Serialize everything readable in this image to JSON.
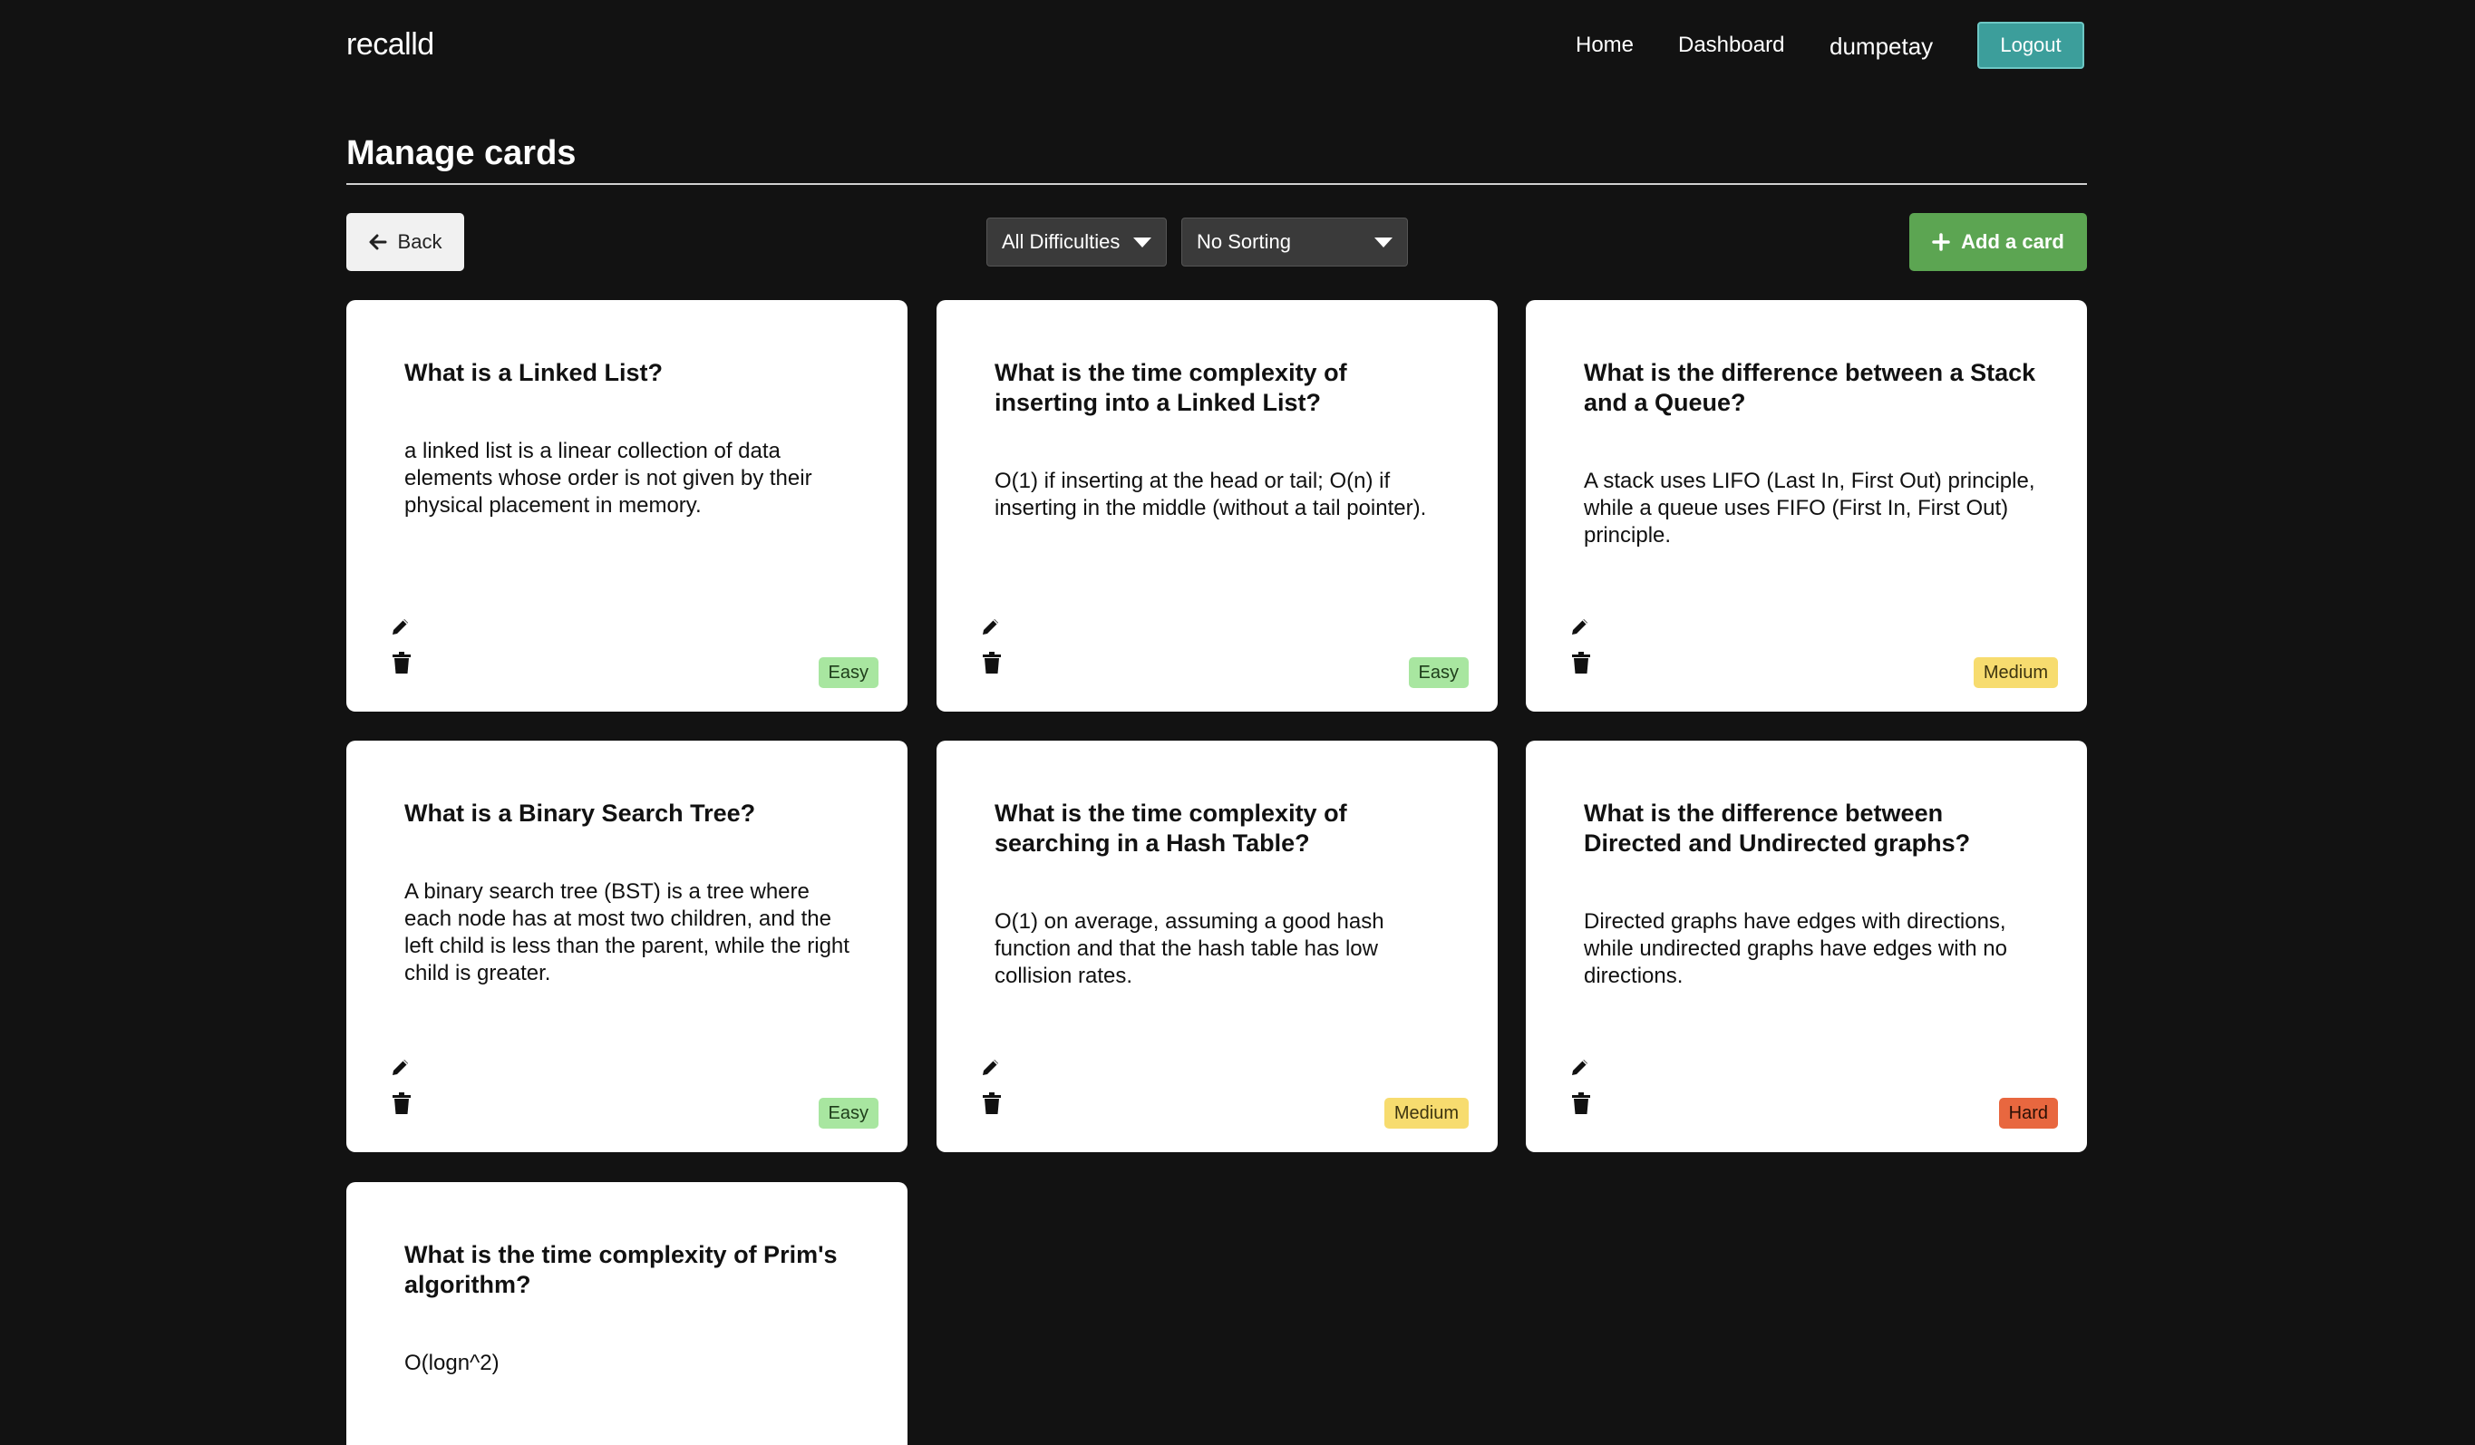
{
  "nav": {
    "brand": "recalld",
    "links": [
      "Home",
      "Dashboard"
    ],
    "username": "dumpetay",
    "logout_label": "Logout"
  },
  "page": {
    "title": "Manage cards"
  },
  "toolbar": {
    "back_label": "Back",
    "difficulty_filter": "All Difficulties",
    "sort_select": "No Sorting",
    "add_label": "Add a card"
  },
  "colors": {
    "background": "#121212",
    "logout": "#3c9e9b",
    "add": "#5ca552",
    "easy": "#a8e6a0",
    "medium": "#f7dc6f",
    "hard": "#e8673f"
  },
  "cards": [
    {
      "question": "What is a Linked List?",
      "answer": "a linked list is a linear collection of data elements whose order is not given by their physical placement in memory.",
      "difficulty": "Easy"
    },
    {
      "question": "What is the time complexity of inserting into a Linked List?",
      "answer": "O(1) if inserting at the head or tail; O(n) if inserting in the middle (without a tail pointer).",
      "difficulty": "Easy"
    },
    {
      "question": "What is the difference between a Stack and a Queue?",
      "answer": "A stack uses LIFO (Last In, First Out) principle, while a queue uses FIFO (First In, First Out) principle.",
      "difficulty": "Medium"
    },
    {
      "question": "What is a Binary Search Tree?",
      "answer": "A binary search tree (BST) is a tree where each node has at most two children, and the left child is less than the parent, while the right child is greater.",
      "difficulty": "Easy"
    },
    {
      "question": "What is the time complexity of searching in a Hash Table?",
      "answer": "O(1) on average, assuming a good hash function and that the hash table has low collision rates.",
      "difficulty": "Medium"
    },
    {
      "question": "What is the difference between Directed and Undirected graphs?",
      "answer": "Directed graphs have edges with directions, while undirected graphs have edges with no directions.",
      "difficulty": "Hard"
    },
    {
      "question": "What is the time complexity of Prim's algorithm?",
      "answer": "O(logn^2)",
      "difficulty": ""
    }
  ]
}
